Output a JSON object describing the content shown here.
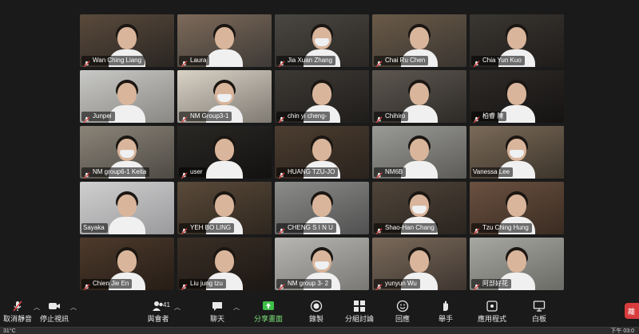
{
  "participants": [
    {
      "name": "Wan Ching Liang",
      "muted": true
    },
    {
      "name": "Laura",
      "muted": true
    },
    {
      "name": "Jia Xuan Zhang",
      "muted": true
    },
    {
      "name": "Chai Ru Chen",
      "muted": true
    },
    {
      "name": "Chia Yun Kuo",
      "muted": true
    },
    {
      "name": "Junpei",
      "muted": true
    },
    {
      "name": "NM Group3-1",
      "muted": true
    },
    {
      "name": "chin yi cheng-",
      "muted": true
    },
    {
      "name": "Chihiro",
      "muted": true
    },
    {
      "name": "柏睿 陳",
      "muted": true
    },
    {
      "name": "NM group6-1 Keita",
      "muted": true
    },
    {
      "name": "user",
      "muted": true
    },
    {
      "name": "HUANG TZU-JO",
      "muted": true
    },
    {
      "name": "NM6B",
      "muted": true
    },
    {
      "name": "Vanessa Lee",
      "muted": false,
      "active_speaker": true
    },
    {
      "name": "Sayaka",
      "muted": false
    },
    {
      "name": "YEH BO LING",
      "muted": true
    },
    {
      "name": "CHENG S I N U",
      "muted": true
    },
    {
      "name": "Shao-Han Chang",
      "muted": true
    },
    {
      "name": "Tzu Ching Hung",
      "muted": true
    },
    {
      "name": "Chien Jie En",
      "muted": true
    },
    {
      "name": "Liu jung tzu",
      "muted": true
    },
    {
      "name": "NM group 3- 2",
      "muted": true
    },
    {
      "name": "yunyun Wu",
      "muted": true
    },
    {
      "name": "阿部好花",
      "muted": true
    }
  ],
  "toolbar": {
    "unmute": "取消靜音",
    "stop_video": "停止視訊",
    "participants": "與會者",
    "participants_count": "41",
    "chat": "聊天",
    "share_screen": "分享畫面",
    "record": "錄製",
    "breakout": "分組討論",
    "reactions": "回應",
    "raise_hand": "舉手",
    "apps": "應用程式",
    "whiteboard": "白板",
    "end": "離"
  },
  "taskbar": {
    "weather": "31°C",
    "clock": "下午 03:0"
  },
  "colors": {
    "background": "#1a1a1a",
    "active_speaker_border": "#c8dc6a",
    "muted_icon": "#e04040",
    "share_green": "#3fbf4a",
    "end_button": "#d83c3c"
  }
}
